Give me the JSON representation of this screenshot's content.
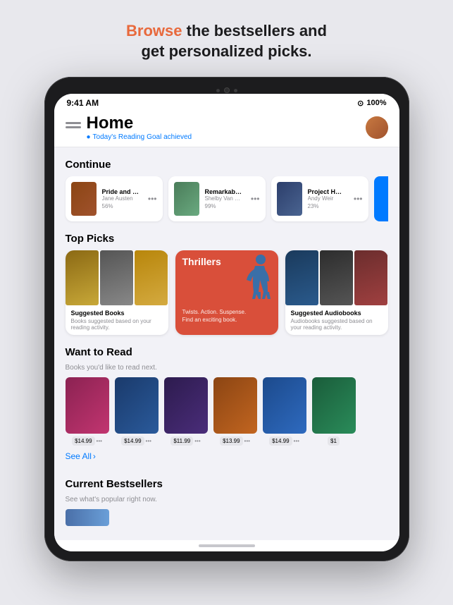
{
  "headline": {
    "prefix": "Browse",
    "suffix": " the bestsellers and\nget personalized picks."
  },
  "statusBar": {
    "time": "9:41 AM",
    "wifi": "▲",
    "battery": "100%"
  },
  "nav": {
    "title": "Home",
    "subtitle": "Today's Reading",
    "subtitleSuffix": "Goal achieved"
  },
  "sections": {
    "continue": {
      "label": "Continue",
      "books": [
        {
          "title": "Pride and Prejudice",
          "author": "Jane Austen",
          "progress": "56%"
        },
        {
          "title": "Remarkably Bright Creatures",
          "author": "Shelby Van Pelt",
          "progress": "99%"
        },
        {
          "title": "Project Hail Mary",
          "author": "Andy Weir",
          "progress": "23%"
        }
      ]
    },
    "topPicks": {
      "label": "Top Picks",
      "cards": [
        {
          "label": "Suggested Books",
          "sublabel": "Books suggested based on your reading activity."
        },
        {
          "label": "Thrillers",
          "sublabel": "Twists. Action. Suspense.\nFind an exciting book."
        },
        {
          "label": "Suggested Audiobooks",
          "sublabel": "Audiobooks suggested based on your reading activity."
        }
      ]
    },
    "wantToRead": {
      "label": "Want to Read",
      "subtitle": "Books you'd like to read next.",
      "books": [
        {
          "price": "$14.99"
        },
        {
          "price": "$14.99"
        },
        {
          "price": "$11.99"
        },
        {
          "price": "$13.99"
        },
        {
          "price": "$14.99"
        },
        {
          "price": "$1"
        }
      ],
      "seeAll": "See All"
    },
    "currentBestsellers": {
      "label": "Current Bestsellers",
      "subtitle": "See what's popular right now."
    }
  }
}
